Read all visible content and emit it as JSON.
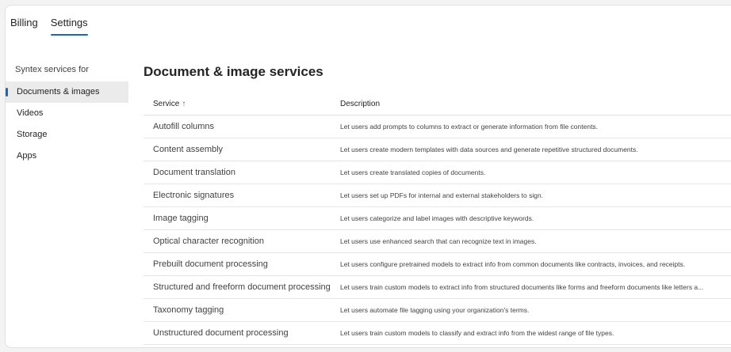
{
  "tabs": [
    {
      "label": "Billing",
      "active": false
    },
    {
      "label": "Settings",
      "active": true
    }
  ],
  "sidebar": {
    "heading": "Syntex services for",
    "items": [
      {
        "label": "Documents & images",
        "selected": true
      },
      {
        "label": "Videos",
        "selected": false
      },
      {
        "label": "Storage",
        "selected": false
      },
      {
        "label": "Apps",
        "selected": false
      }
    ]
  },
  "main": {
    "title": "Document & image services",
    "columns": {
      "service": "Service",
      "service_sort_icon": "↑",
      "description": "Description"
    },
    "rows": [
      {
        "service": "Autofill columns",
        "description": "Let users add prompts to columns to extract or generate information from file contents."
      },
      {
        "service": "Content assembly",
        "description": "Let users create modern templates with data sources and generate repetitive structured documents."
      },
      {
        "service": "Document translation",
        "description": "Let users create translated copies of documents."
      },
      {
        "service": "Electronic signatures",
        "description": "Let users set up PDFs for internal and external stakeholders to sign."
      },
      {
        "service": "Image tagging",
        "description": "Let users categorize and label images with descriptive keywords."
      },
      {
        "service": "Optical character recognition",
        "description": "Let users use enhanced search that can recognize text in images."
      },
      {
        "service": "Prebuilt document processing",
        "description": "Let users configure pretrained models to extract info from common documents like contracts, invoices, and receipts."
      },
      {
        "service": "Structured and freeform document processing",
        "description": "Let users train custom models to extract info from structured documents like forms and freeform documents like letters a..."
      },
      {
        "service": "Taxonomy tagging",
        "description": "Let users automate file tagging using your organization's terms."
      },
      {
        "service": "Unstructured document processing",
        "description": "Let users train custom models to classify and extract info from the widest range of file types."
      }
    ]
  },
  "colors": {
    "accent": "#0f6cbd",
    "selected_bg": "#ebebeb"
  }
}
